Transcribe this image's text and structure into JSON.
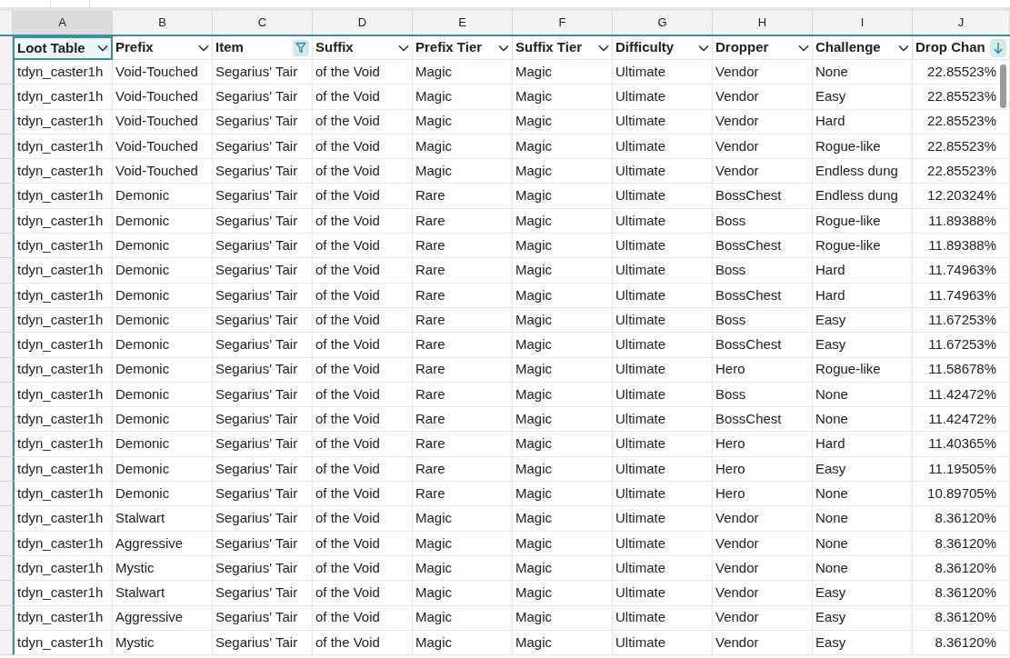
{
  "columns": [
    {
      "letter": "A",
      "title": "Loot Table",
      "kind": "dropdown",
      "selected": true
    },
    {
      "letter": "B",
      "title": "Prefix",
      "kind": "dropdown",
      "selected": false
    },
    {
      "letter": "C",
      "title": "Item",
      "kind": "filtered",
      "selected": false
    },
    {
      "letter": "D",
      "title": "Suffix",
      "kind": "dropdown",
      "selected": false
    },
    {
      "letter": "E",
      "title": "Prefix Tier",
      "kind": "dropdown",
      "selected": false
    },
    {
      "letter": "F",
      "title": "Suffix Tier",
      "kind": "dropdown",
      "selected": false
    },
    {
      "letter": "G",
      "title": "Difficulty",
      "kind": "dropdown",
      "selected": false
    },
    {
      "letter": "H",
      "title": "Dropper",
      "kind": "dropdown",
      "selected": false
    },
    {
      "letter": "I",
      "title": "Challenge",
      "kind": "dropdown",
      "selected": false
    },
    {
      "letter": "J",
      "title": "Drop Chan",
      "kind": "sorted",
      "selected": false
    }
  ],
  "rows": [
    [
      "tdyn_caster1h",
      "Void-Touched",
      "Segarius' Tair",
      "of the Void",
      "Magic",
      "Magic",
      "Ultimate",
      "Vendor",
      "None",
      "22.85523%"
    ],
    [
      "tdyn_caster1h",
      "Void-Touched",
      "Segarius' Tair",
      "of the Void",
      "Magic",
      "Magic",
      "Ultimate",
      "Vendor",
      "Easy",
      "22.85523%"
    ],
    [
      "tdyn_caster1h",
      "Void-Touched",
      "Segarius' Tair",
      "of the Void",
      "Magic",
      "Magic",
      "Ultimate",
      "Vendor",
      "Hard",
      "22.85523%"
    ],
    [
      "tdyn_caster1h",
      "Void-Touched",
      "Segarius' Tair",
      "of the Void",
      "Magic",
      "Magic",
      "Ultimate",
      "Vendor",
      "Rogue-like",
      "22.85523%"
    ],
    [
      "tdyn_caster1h",
      "Void-Touched",
      "Segarius' Tair",
      "of the Void",
      "Magic",
      "Magic",
      "Ultimate",
      "Vendor",
      "Endless dung",
      "22.85523%"
    ],
    [
      "tdyn_caster1h",
      "Demonic",
      "Segarius' Tair",
      "of the Void",
      "Rare",
      "Magic",
      "Ultimate",
      "BossChest",
      "Endless dung",
      "12.20324%"
    ],
    [
      "tdyn_caster1h",
      "Demonic",
      "Segarius' Tair",
      "of the Void",
      "Rare",
      "Magic",
      "Ultimate",
      "Boss",
      "Rogue-like",
      "11.89388%"
    ],
    [
      "tdyn_caster1h",
      "Demonic",
      "Segarius' Tair",
      "of the Void",
      "Rare",
      "Magic",
      "Ultimate",
      "BossChest",
      "Rogue-like",
      "11.89388%"
    ],
    [
      "tdyn_caster1h",
      "Demonic",
      "Segarius' Tair",
      "of the Void",
      "Rare",
      "Magic",
      "Ultimate",
      "Boss",
      "Hard",
      "11.74963%"
    ],
    [
      "tdyn_caster1h",
      "Demonic",
      "Segarius' Tair",
      "of the Void",
      "Rare",
      "Magic",
      "Ultimate",
      "BossChest",
      "Hard",
      "11.74963%"
    ],
    [
      "tdyn_caster1h",
      "Demonic",
      "Segarius' Tair",
      "of the Void",
      "Rare",
      "Magic",
      "Ultimate",
      "Boss",
      "Easy",
      "11.67253%"
    ],
    [
      "tdyn_caster1h",
      "Demonic",
      "Segarius' Tair",
      "of the Void",
      "Rare",
      "Magic",
      "Ultimate",
      "BossChest",
      "Easy",
      "11.67253%"
    ],
    [
      "tdyn_caster1h",
      "Demonic",
      "Segarius' Tair",
      "of the Void",
      "Rare",
      "Magic",
      "Ultimate",
      "Hero",
      "Rogue-like",
      "11.58678%"
    ],
    [
      "tdyn_caster1h",
      "Demonic",
      "Segarius' Tair",
      "of the Void",
      "Rare",
      "Magic",
      "Ultimate",
      "Boss",
      "None",
      "11.42472%"
    ],
    [
      "tdyn_caster1h",
      "Demonic",
      "Segarius' Tair",
      "of the Void",
      "Rare",
      "Magic",
      "Ultimate",
      "BossChest",
      "None",
      "11.42472%"
    ],
    [
      "tdyn_caster1h",
      "Demonic",
      "Segarius' Tair",
      "of the Void",
      "Rare",
      "Magic",
      "Ultimate",
      "Hero",
      "Hard",
      "11.40365%"
    ],
    [
      "tdyn_caster1h",
      "Demonic",
      "Segarius' Tair",
      "of the Void",
      "Rare",
      "Magic",
      "Ultimate",
      "Hero",
      "Easy",
      "11.19505%"
    ],
    [
      "tdyn_caster1h",
      "Demonic",
      "Segarius' Tair",
      "of the Void",
      "Rare",
      "Magic",
      "Ultimate",
      "Hero",
      "None",
      "10.89705%"
    ],
    [
      "tdyn_caster1h",
      "Stalwart",
      "Segarius' Tair",
      "of the Void",
      "Magic",
      "Magic",
      "Ultimate",
      "Vendor",
      "None",
      "8.36120%"
    ],
    [
      "tdyn_caster1h",
      "Aggressive",
      "Segarius' Tair",
      "of the Void",
      "Magic",
      "Magic",
      "Ultimate",
      "Vendor",
      "None",
      "8.36120%"
    ],
    [
      "tdyn_caster1h",
      "Mystic",
      "Segarius' Tair",
      "of the Void",
      "Magic",
      "Magic",
      "Ultimate",
      "Vendor",
      "None",
      "8.36120%"
    ],
    [
      "tdyn_caster1h",
      "Stalwart",
      "Segarius' Tair",
      "of the Void",
      "Magic",
      "Magic",
      "Ultimate",
      "Vendor",
      "Easy",
      "8.36120%"
    ],
    [
      "tdyn_caster1h",
      "Aggressive",
      "Segarius' Tair",
      "of the Void",
      "Magic",
      "Magic",
      "Ultimate",
      "Vendor",
      "Easy",
      "8.36120%"
    ],
    [
      "tdyn_caster1h",
      "Mystic",
      "Segarius' Tair",
      "of the Void",
      "Magic",
      "Magic",
      "Ultimate",
      "Vendor",
      "Easy",
      "8.36120%"
    ]
  ]
}
